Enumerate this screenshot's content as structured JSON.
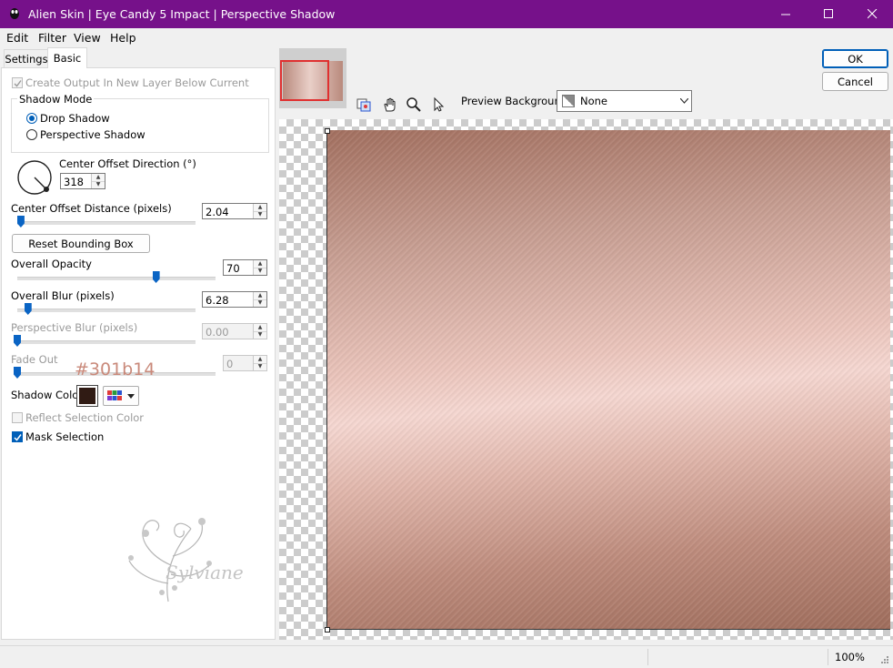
{
  "window": {
    "title": "Alien Skin | Eye Candy 5 Impact | Perspective Shadow"
  },
  "menu": [
    {
      "label": "Edit"
    },
    {
      "label": "Filter"
    },
    {
      "label": "View"
    },
    {
      "label": "Help"
    }
  ],
  "tabs": [
    {
      "label": "Settings"
    },
    {
      "label": "Basic"
    }
  ],
  "basic": {
    "create_output_label": "Create Output In New Layer Below Current",
    "create_output_checked": true,
    "shadow_mode_label": "Shadow Mode",
    "shadow_mode_options": [
      "Drop Shadow",
      "Perspective Shadow"
    ],
    "shadow_mode_selected": "Drop Shadow",
    "center_offset_direction_label": "Center Offset Direction (°)",
    "center_offset_direction_value": "318",
    "center_offset_distance_label": "Center Offset Distance (pixels)",
    "center_offset_distance_value": "2.04",
    "center_offset_distance_level": 0.02,
    "reset_bounding_box_label": "Reset Bounding Box",
    "overall_opacity_label": "Overall Opacity",
    "overall_opacity_value": "70",
    "overall_opacity_level": 0.7,
    "overall_blur_label": "Overall Blur (pixels)",
    "overall_blur_value": "6.28",
    "overall_blur_level": 0.06,
    "perspective_blur_label": "Perspective Blur (pixels)",
    "perspective_blur_value": "0.00",
    "perspective_blur_level": 0,
    "fade_out_label": "Fade Out",
    "fade_out_value": "0",
    "fade_out_level": 0,
    "color_annotation": "#301b14",
    "shadow_color_label": "Shadow Color",
    "shadow_color": "#301b14",
    "reflect_selection_color_label": "Reflect Selection Color",
    "reflect_selection_color_checked": false,
    "mask_selection_label": "Mask Selection",
    "mask_selection_checked": true,
    "watermark_text": "Sylviane"
  },
  "buttons": {
    "ok_label": "OK",
    "cancel_label": "Cancel"
  },
  "preview": {
    "background_label": "Preview Background:",
    "background_value": "None"
  },
  "status": {
    "zoom": "100%"
  },
  "colors": {
    "titlebar": "#76118a",
    "accent": "#005fb8",
    "preview_light": "#f6d8d2",
    "preview_dark": "#a06e5d"
  }
}
